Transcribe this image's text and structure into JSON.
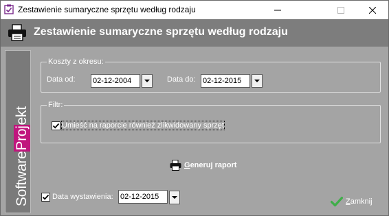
{
  "window": {
    "title": "Zestawienie sumaryczne sprzętu według rodzaju",
    "controls": {
      "minimize": "minimize-icon",
      "maximize": "maximize-icon",
      "close": "close-icon"
    }
  },
  "header": {
    "title": "Zestawienie sumaryczne sprzętu według rodzaju",
    "icon": "printer-icon"
  },
  "brand": {
    "text_part1": "Software",
    "text_part2": "Proj",
    "text_part3": "ekt",
    "accent_color": "#c0167d"
  },
  "costs": {
    "legend": "Koszty z okresu:",
    "date_from_label": "Data od:",
    "date_from_value": "02-12-2004",
    "date_to_label": "Data do:",
    "date_to_value": "02-12-2015"
  },
  "filter": {
    "legend": "Filtr:",
    "include_liquidated_label": "Umieść na raporcie również zlikwidowany sprzęt",
    "include_liquidated_checked": true
  },
  "generate": {
    "label_first": "G",
    "label_rest": "eneruj raport",
    "icon": "printer-icon"
  },
  "issue_date": {
    "checked": true,
    "label": "Data wystawienia:",
    "value": "02-12-2015"
  },
  "close": {
    "label_first": "Z",
    "label_rest": "amknij",
    "icon": "checkmark-icon"
  },
  "colors": {
    "background": "#a4a4a4",
    "header": "#7d7d7d",
    "check_green": "#3fae49"
  }
}
